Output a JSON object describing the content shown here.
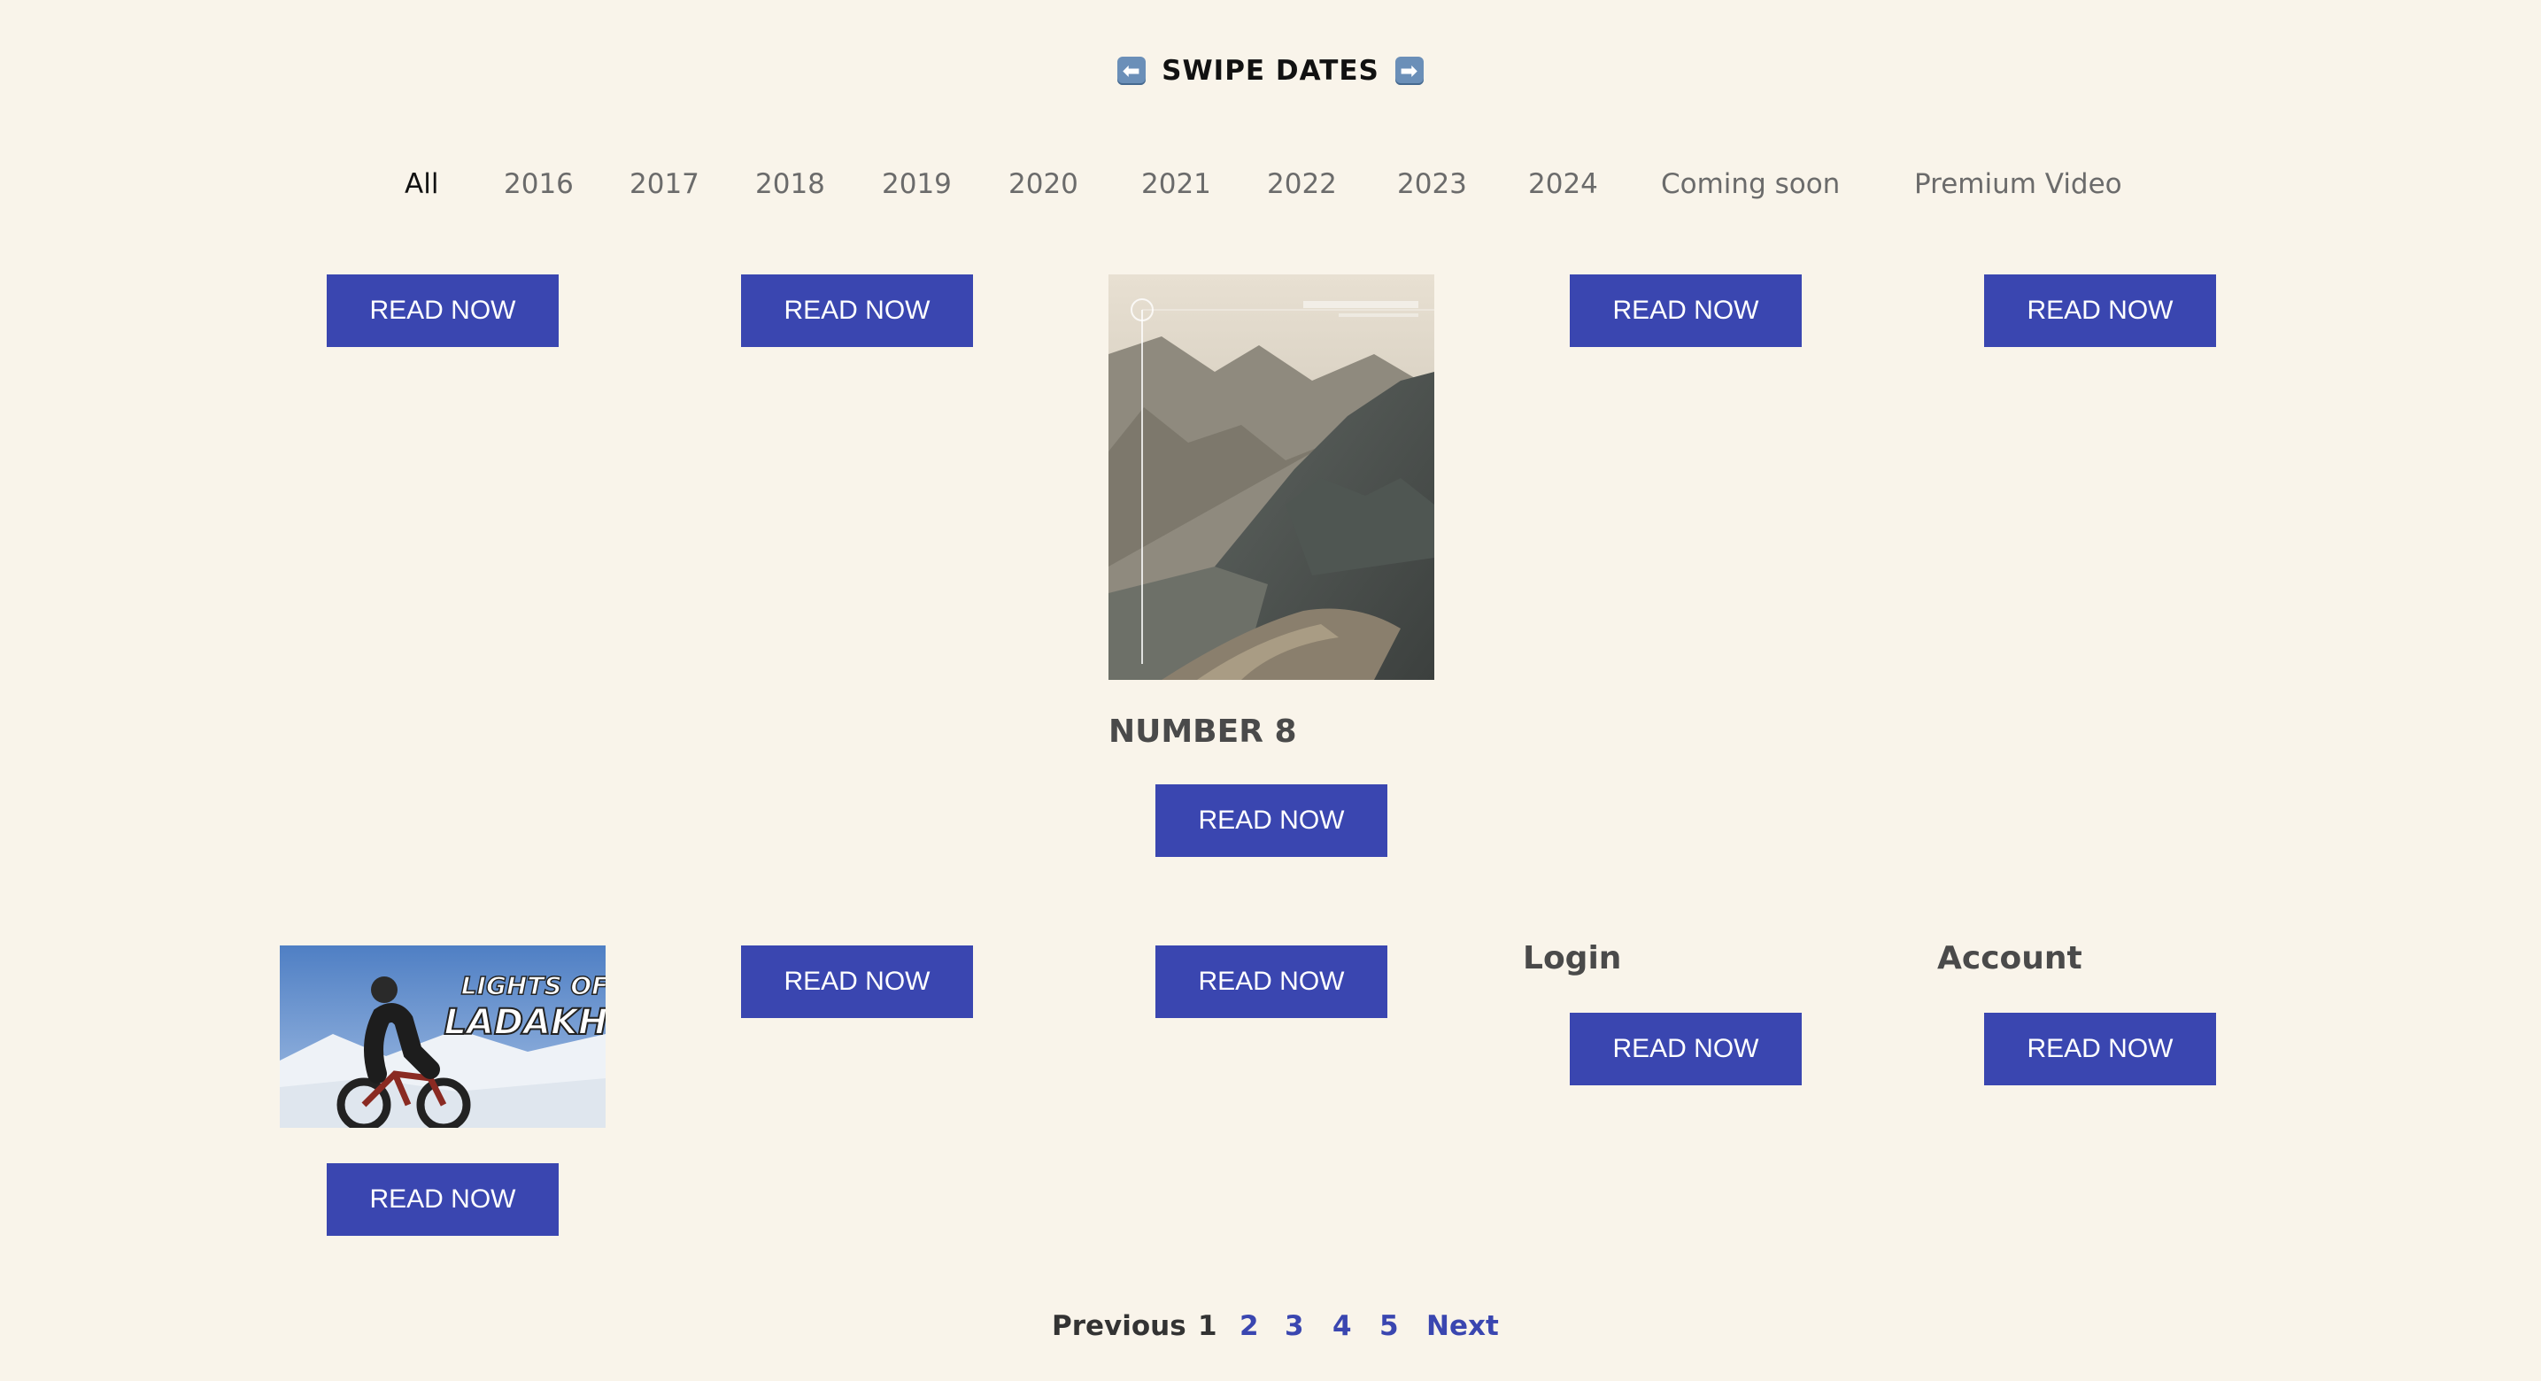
{
  "header": {
    "title": "SWIPE DATES",
    "left_icon": "left-arrow-icon",
    "right_icon": "right-arrow-icon"
  },
  "filters": [
    {
      "label": "All",
      "active": true
    },
    {
      "label": "2016"
    },
    {
      "label": "2017"
    },
    {
      "label": "2018"
    },
    {
      "label": "2019"
    },
    {
      "label": "2020"
    },
    {
      "label": "2021"
    },
    {
      "label": "2022"
    },
    {
      "label": "2023"
    },
    {
      "label": "2024"
    },
    {
      "label": "Coming soon"
    },
    {
      "label": "Premium Video"
    }
  ],
  "cards": {
    "read_label": "READ NOW",
    "number8_title": "NUMBER 8",
    "login_title": "Login",
    "account_title": "Account",
    "ladakh_image_text": [
      "LIGHTS OF",
      "LADAKH"
    ]
  },
  "pagination": {
    "previous": "Previous",
    "pages": [
      "1",
      "2",
      "3",
      "4",
      "5"
    ],
    "current": "1",
    "next": "Next"
  },
  "colors": {
    "background": "#f9f4ea",
    "button": "#3a46b0",
    "link": "#3a46b0"
  }
}
